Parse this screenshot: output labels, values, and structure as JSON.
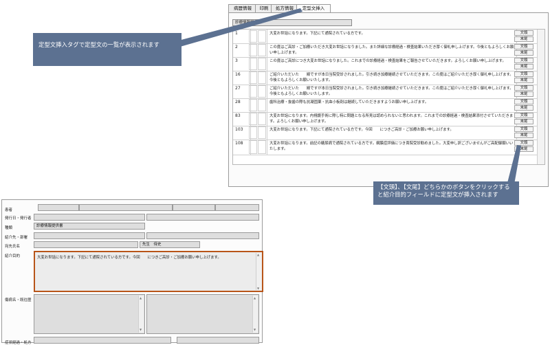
{
  "tabs": [
    {
      "label": "病歴情報",
      "active": false
    },
    {
      "label": "印刷",
      "active": false
    },
    {
      "label": "処方情報",
      "active": false
    },
    {
      "label": "定型文挿入",
      "active": true
    }
  ],
  "ref_document_label": "診療情報提供書",
  "template_buttons": {
    "head": "文頭",
    "tail": "末尾"
  },
  "templates": [
    {
      "no": "1",
      "text": "大変お世話になります。下記にて通院されている方です。"
    },
    {
      "no": "2",
      "text": "この度はご高診・ご加療いただき大変お世話になりました。また詳細な診療経過・検査結果いただき厚く御礼申し上げます。今後ともよろしくお願い申し上げます。"
    },
    {
      "no": "3",
      "text": "この度はご高診につき大変お世話になりました。これまでの診療経過・検査結果をご報告させていただきます。よろしくお願い申し上げます。"
    },
    {
      "no": "16",
      "text": "ご紹介いただいた　　殿ですが本日当院受診されました。引き続き加療継続させていただきます。この度はご紹介いただき厚く御礼申し上げます。今後ともよろしくお願いいたします。"
    },
    {
      "no": "27",
      "text": "ご紹介いただいた　　殿ですが本日当院受診されました。引き続き加療継続させていただきます。この度はご紹介いただき厚く御礼申し上げます。今後ともよろしくお願いいたします。"
    },
    {
      "no": "28",
      "text": "歯科治療・抜歯の際も抗凝固薬・抗血小板剤は継続していただきますようお願い申し上げます。"
    },
    {
      "no": "83",
      "text": "大変お世話になります。内視鏡手術に際し特に問題となる所見は認められないと思われます。これまでの診療経過・検査結果添付させていただきます。よろしくお願い申し上げます。"
    },
    {
      "no": "103",
      "text": "大変お世話になります。下記にて通院されている方です。今回　　につきご高診・ご加療お願い申し上げます。"
    },
    {
      "no": "108",
      "text": "大変お世話になります。前記の糖尿病で通院されている方です。網膜症評価につき貴院受診勧めました。大変申し訳ございませんがご高配御願いいたします。"
    }
  ],
  "callouts": {
    "tab_hint": "定型文挿入タグで定型文の一覧が表示されます",
    "button_hint": "【文頭】、【文尾】どちらかのボタンをクリックすると紹介目的フィールドに定型文が挿入されます"
  },
  "form": {
    "labels": {
      "patient": "患者",
      "issue_date": "発行日・発行者",
      "type": "種類",
      "refer_to": "紹介先・部署",
      "doctor_name": "宛先氏名",
      "purpose": "紹介目的",
      "diagnosis": "傷病名・既往歴",
      "course": "症状経過・処方"
    },
    "type_value": "診療情報提供書",
    "doctor_honorific": "先生　侍史",
    "purpose_text": "大変お世話になります。下記にて通院されている方です。今回　　につきご高診・ご加療お願い申し上げます。"
  }
}
